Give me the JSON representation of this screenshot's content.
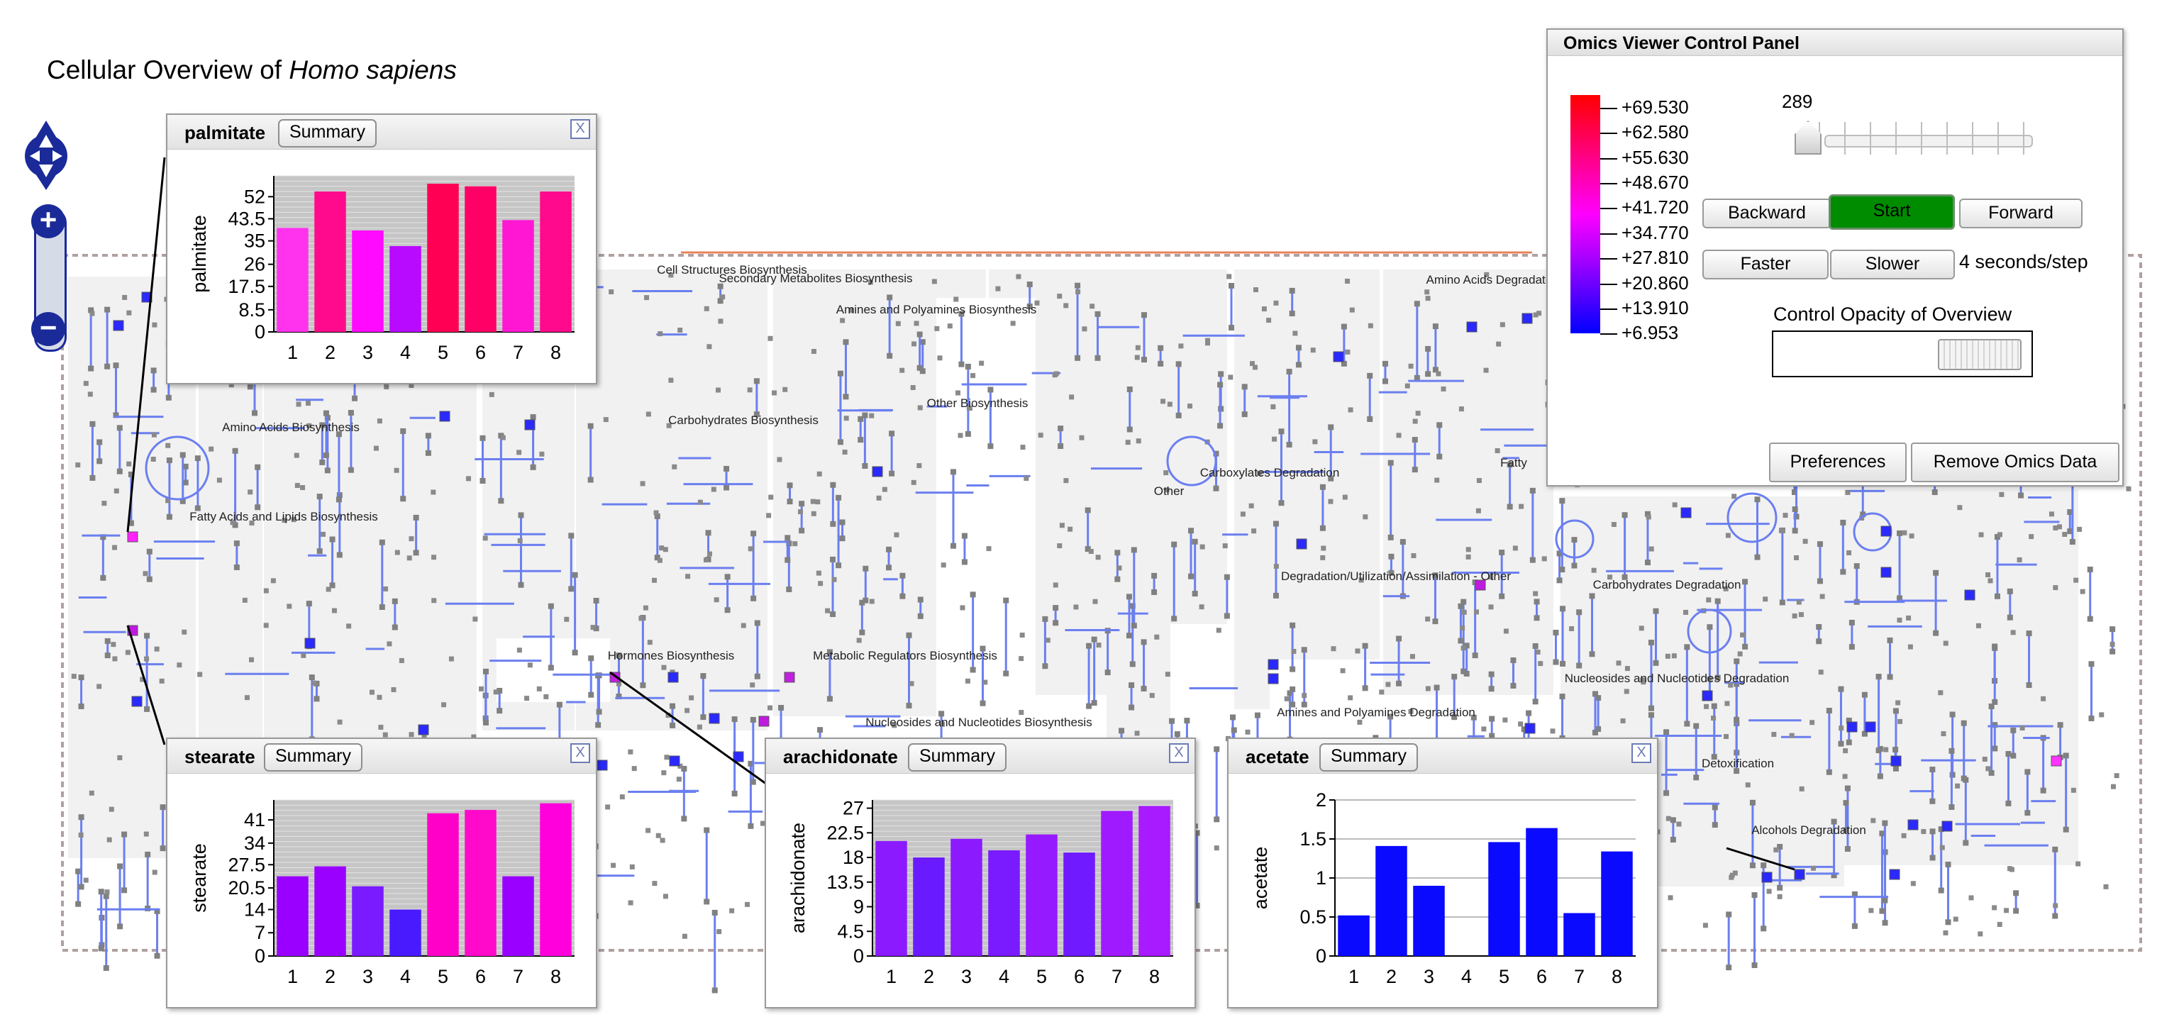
{
  "page": {
    "title_prefix": "Cellular Overview of ",
    "title_species": "Homo sapiens"
  },
  "overview": {
    "region_labels": [
      "Cell Structures Biosynthesis",
      "Secondary Metabolites Biosynthesis",
      "Amines and Polyamines Biosynthesis",
      "Carbohydrates Biosynthesis",
      "Other Biosynthesis",
      "Amino Acids Biosynthesis",
      "Fatty Acids and Lipids Biosynthesis",
      "Hormones Biosynthesis",
      "Metabolic Regulators Biosynthesis",
      "Nucleosides and Nucleotides Biosynthesis",
      "Other",
      "Carboxylates Degradation",
      "Degradation/Utilization/Assimilation - Other",
      "Carbohydrates Degradation",
      "Nucleosides and Nucleotides Degradation",
      "Amines and Polyamines Degradation",
      "Detoxification",
      "Alcohols Degradation",
      "Amino Acids Degradation",
      "Fatty"
    ]
  },
  "popups": [
    {
      "id": "palmitate",
      "name": "palmitate",
      "summary_label": "Summary",
      "close_label": "X",
      "chart_data": {
        "type": "bar",
        "ylabel": "palmitate",
        "categories": [
          "1",
          "2",
          "3",
          "4",
          "5",
          "6",
          "7",
          "8"
        ],
        "values": [
          40,
          54,
          39,
          33,
          57,
          56,
          43,
          54
        ],
        "yticks": [
          "52",
          "43.5",
          "35",
          "26",
          "17.5",
          "8.5",
          "0"
        ],
        "ylim": [
          0,
          60
        ],
        "bar_colors": [
          "#ff33ee",
          "#ff0a8c",
          "#ff0aff",
          "#b80aff",
          "#ff0055",
          "#ff0066",
          "#ff17d4",
          "#ff0a8c"
        ],
        "background": "#c6c6c6"
      }
    },
    {
      "id": "stearate",
      "name": "stearate",
      "summary_label": "Summary",
      "close_label": "X",
      "chart_data": {
        "type": "bar",
        "ylabel": "stearate",
        "categories": [
          "1",
          "2",
          "3",
          "4",
          "5",
          "6",
          "7",
          "8"
        ],
        "values": [
          24,
          27,
          21,
          14,
          43,
          44,
          24,
          46
        ],
        "yticks": [
          "41",
          "34",
          "27.5",
          "20.5",
          "14",
          "7",
          "0"
        ],
        "ylim": [
          0,
          47
        ],
        "bar_colors": [
          "#9900ff",
          "#9a00ff",
          "#7a1aff",
          "#4a1aff",
          "#ff00c8",
          "#ff0aca",
          "#9900ff",
          "#ff00dc"
        ],
        "background": "#c6c6c6"
      }
    },
    {
      "id": "arachidonate",
      "name": "arachidonate",
      "summary_label": "Summary",
      "close_label": "X",
      "chart_data": {
        "type": "bar",
        "ylabel": "arachidonate",
        "categories": [
          "1",
          "2",
          "3",
          "4",
          "5",
          "6",
          "7",
          "8"
        ],
        "values": [
          21,
          18,
          21.4,
          19.3,
          22.2,
          18.9,
          26.5,
          27.4
        ],
        "yticks": [
          "27",
          "22.5",
          "18",
          "13.5",
          "9",
          "4.5",
          "0"
        ],
        "ylim": [
          0,
          28.5
        ],
        "bar_colors": [
          "#8c1aff",
          "#6a1aff",
          "#8c1aff",
          "#7a1aff",
          "#961aff",
          "#6f1aff",
          "#a01aff",
          "#a81aff"
        ],
        "background": "#c6c6c6"
      }
    },
    {
      "id": "acetate",
      "name": "acetate",
      "summary_label": "Summary",
      "close_label": "X",
      "chart_data": {
        "type": "bar",
        "ylabel": "acetate",
        "categories": [
          "1",
          "2",
          "3",
          "4",
          "5",
          "6",
          "7",
          "8"
        ],
        "values": [
          0.52,
          1.41,
          0.9,
          0,
          1.46,
          1.64,
          0.55,
          1.34
        ],
        "yticks": [
          "2",
          "1.5",
          "1",
          "0.5",
          "0"
        ],
        "ylim": [
          0,
          2
        ],
        "bar_colors": [
          "#0a0aff",
          "#0a0aff",
          "#0a0aff",
          "#0a0aff",
          "#0a0aff",
          "#0a0aff",
          "#0a0aff",
          "#0a0aff"
        ],
        "background": "#ffffff"
      }
    }
  ],
  "control_panel": {
    "title": "Omics Viewer Control Panel",
    "legend_labels": [
      "+69.530",
      "+62.580",
      "+55.630",
      "+48.670",
      "+41.720",
      "+34.770",
      "+27.810",
      "+20.860",
      "+13.910",
      "+6.953"
    ],
    "slider_value": "289",
    "slider_level_fraction": 0,
    "buttons": {
      "backward": "Backward",
      "start": "Start",
      "forward": "Forward",
      "faster": "Faster",
      "slower": "Slower",
      "preferences": "Preferences",
      "remove_omics": "Remove Omics Data"
    },
    "speed_text": "4 seconds/step",
    "opacity_label": "Control Opacity of Overview",
    "opacity_level_fraction": 0.95
  }
}
